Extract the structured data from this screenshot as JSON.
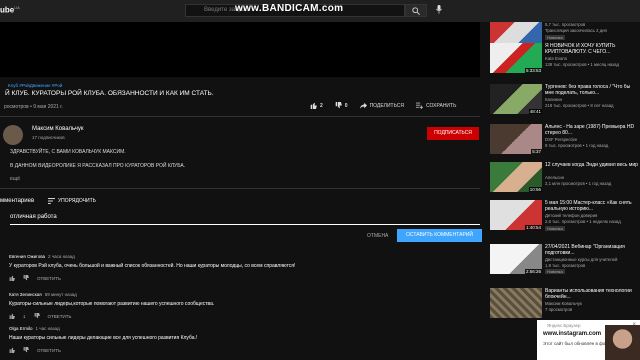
{
  "header": {
    "logo_text": "ube",
    "logo_sup": "UA",
    "search_placeholder": "Введите запрос",
    "watermark": "www.BANDICAM.com"
  },
  "video": {
    "hashtags": "Клуб #РойДвижение #Рой",
    "title": "Й КЛУБ. КУРАТОРЫ РОЙ КЛУБА. ОБЯЗАННОСТИ И КАК ИМ СТАТЬ.",
    "meta": "росмотров • 9 мая 2021 г.",
    "likes": "2",
    "dislikes": "0",
    "share_label": "ПОДЕЛИТЬСЯ",
    "save_label": "СОХРАНИТЬ"
  },
  "channel": {
    "name": "Максим Ковальчук",
    "subscribers": "17 подписчиков",
    "subscribe_label": "ПОДПИСАТЬСЯ",
    "desc_line1": "ЗДРАВСТВУЙТЕ, С ВАМИ КОВАЛЬЧУК МАКСИМ.",
    "desc_line2": "В ДАННОМ ВИДЕОРОЛИКЕ Я РАССКАЗАЛ ПРО КУРАТОРОВ РОЙ КЛУБА.",
    "more_label": "ЕЩЁ"
  },
  "comments": {
    "header": "мментариев",
    "sort_label": "УПОРЯДОЧИТЬ",
    "input_value": "отличная работа",
    "cancel_label": "ОТМЕНА",
    "post_label": "ОСТАВИТЬ КОММЕНТАРИЙ",
    "reply_label": "ОТВЕТИТЬ",
    "items": [
      {
        "author": "Евгения Ожигова",
        "time": "2 часа назад",
        "text": "У кураторов Рэй клуба, очень большой и важный список обязанностей. Но наши кураторы молодцы, со всем справляются!",
        "likes": ""
      },
      {
        "author": "Катя Зелинская",
        "time": "59 минут назад",
        "text": "Кураторы-сильные лидеры,которые помогают развитию нашего успешного сообщества.",
        "likes": "1"
      },
      {
        "author": "Olga Ermilo",
        "time": "1 час назад",
        "text": "Наши кураторы сильные лидеры делающие все для успешного развития Клуба.!",
        "likes": ""
      }
    ]
  },
  "related": [
    {
      "title": "",
      "channel": "5,7 тыс. просмотров",
      "meta": "Трансляция закончилась 2 дня",
      "badge": "Новинка",
      "duration": ""
    },
    {
      "title": "Я НОВИЧОК И ХОЧУ КУПИТЬ КРИПТОВАЛЮТУ. С ЧЕГО...",
      "channel": "Kate Evans",
      "meta": "138 тыс. просмотров • 1 месяц назад",
      "badge": "",
      "duration": "5:33:53"
    },
    {
      "title": "Тургенев: без права голоса / \"Что бы мне поделать, только...",
      "channel": "Калинин",
      "meta": "218 тыс. просмотров • 8 лет назад",
      "badge": "",
      "duration": "48:41"
    },
    {
      "title": "Альянс - На заре (1987) Премьера HD стерео 80...",
      "channel": "DSF Perspective",
      "meta": "9 тыс. просмотров • 1 год назад",
      "badge": "",
      "duration": "5:37"
    },
    {
      "title": "12 случаев когда Энди удивил весь мир",
      "channel": "Апельсин",
      "meta": "2,1 млн просмотров • 1 год назад",
      "badge": "",
      "duration": "10:56"
    },
    {
      "title": "5 мая 15:00 Мастер-класс «Как снять реальную историю...",
      "channel": "Детский телефон доверия",
      "meta": "2,6 тыс. просмотров • 1 неделю назад",
      "badge": "Новинка",
      "duration": "1:40:54"
    },
    {
      "title": "27/04/2021 Вебинар \"Организация подготовки...",
      "channel": "Дистанционные курсы для учителей",
      "meta": "1,9 тыс. просмотров",
      "badge": "Новинка",
      "duration": "2:56:26"
    },
    {
      "title": "Варианты использования технологии блокчейн...",
      "channel": "Максим Ковальчук",
      "meta": "7 просмотров",
      "badge": "",
      "duration": ""
    }
  ],
  "popup": {
    "browser": "Яндекс.Браузер",
    "site": "www.instagram.com",
    "message": "Этот сайт был обновлён в фоновой режи"
  }
}
